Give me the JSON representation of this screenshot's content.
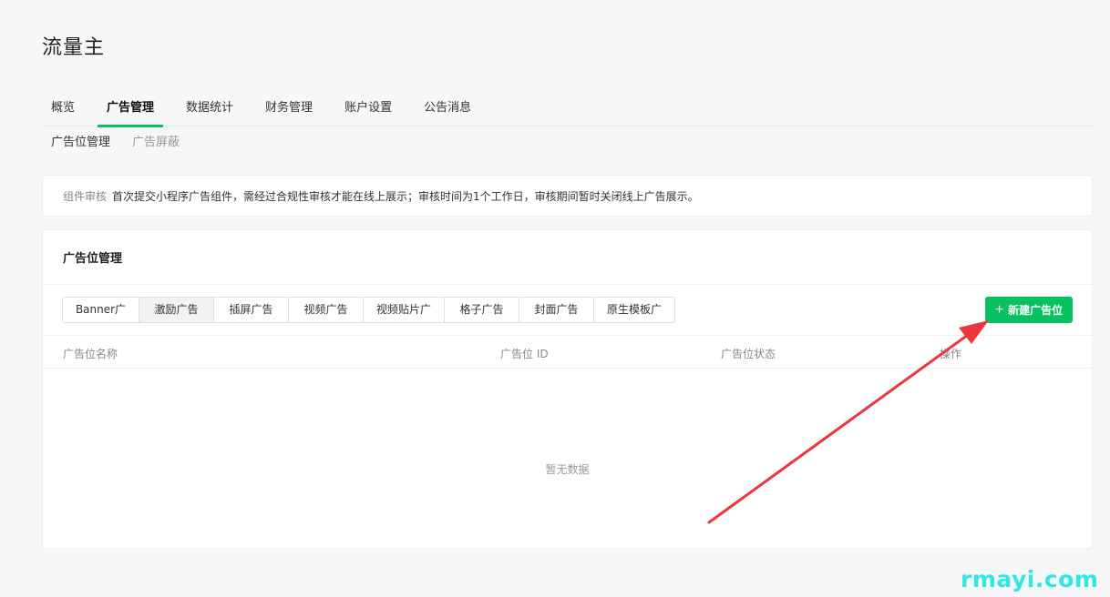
{
  "app": {
    "title": "流量主"
  },
  "main_tabs": [
    {
      "label": "概览",
      "active": false
    },
    {
      "label": "广告管理",
      "active": true
    },
    {
      "label": "数据统计",
      "active": false
    },
    {
      "label": "财务管理",
      "active": false
    },
    {
      "label": "账户设置",
      "active": false
    },
    {
      "label": "公告消息",
      "active": false
    }
  ],
  "sub_tabs": [
    {
      "label": "广告位管理",
      "active": true
    },
    {
      "label": "广告屏蔽",
      "active": false
    }
  ],
  "notice": {
    "label": "组件审核",
    "text": "首次提交小程序广告组件，需经过合规性审核才能在线上展示；审核时间为1个工作日，审核期间暂时关闭线上广告展示。"
  },
  "ad_card": {
    "title": "广告位管理",
    "ad_types": [
      {
        "label": "Banner广告",
        "active": false
      },
      {
        "label": "激励广告",
        "active": true
      },
      {
        "label": "插屏广告",
        "active": false
      },
      {
        "label": "视频广告",
        "active": false
      },
      {
        "label": "视频贴片广告",
        "active": false
      },
      {
        "label": "格子广告",
        "active": false
      },
      {
        "label": "封面广告",
        "active": false
      },
      {
        "label": "原生模板广告",
        "active": false
      }
    ],
    "new_button": {
      "icon": "plus-icon",
      "label": "新建广告位"
    },
    "columns": [
      "广告位名称",
      "广告位 ID",
      "广告位状态",
      "操作"
    ],
    "empty_text": "暂无数据"
  },
  "watermark": "rmayi.com",
  "colors": {
    "accent": "#07c160",
    "annotation_arrow": "#e8383d",
    "watermark": "#33e6e6"
  }
}
